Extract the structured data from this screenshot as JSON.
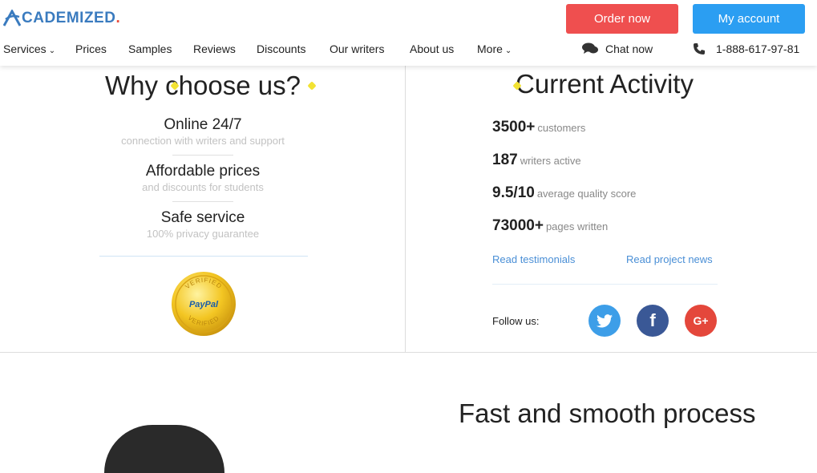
{
  "brand": {
    "name": "CADEMIZED",
    "dot": ".",
    "colors": {
      "primary": "#3a7bbf",
      "accent": "#e84c3d"
    }
  },
  "header": {
    "order_label": "Order now",
    "account_label": "My account",
    "chat_label": "Chat now",
    "phone": "1-888-617-97-81",
    "nav": [
      {
        "label": "Services"
      },
      {
        "label": "Prices"
      },
      {
        "label": "Samples"
      },
      {
        "label": "Reviews"
      },
      {
        "label": "Discounts"
      },
      {
        "label": "Our writers"
      },
      {
        "label": "About us"
      },
      {
        "label": "More"
      }
    ]
  },
  "why": {
    "title": "Why choose us?",
    "features": [
      {
        "title": "Online 24/7",
        "subtitle": "connection with writers and support"
      },
      {
        "title": "Affordable prices",
        "subtitle": "and discounts for students"
      },
      {
        "title": "Safe service",
        "subtitle": "100% privacy guarantee"
      }
    ],
    "seal": {
      "top": "VERIFIED",
      "center": "PayPal",
      "bottom": "VERIFIED"
    }
  },
  "activity": {
    "title": "Current Activity",
    "stats": [
      {
        "value": "3500+",
        "label": "customers"
      },
      {
        "value": "187",
        "label": "writers active"
      },
      {
        "value": "9.5/10",
        "label": "average quality score"
      },
      {
        "value": "73000+",
        "label": "pages written"
      }
    ],
    "link_testimonials": "Read testimonials",
    "link_news": "Read project news",
    "follow_label": "Follow us:",
    "social": {
      "facebook": "f",
      "google": "G+"
    }
  },
  "process": {
    "title": "Fast and smooth process"
  }
}
